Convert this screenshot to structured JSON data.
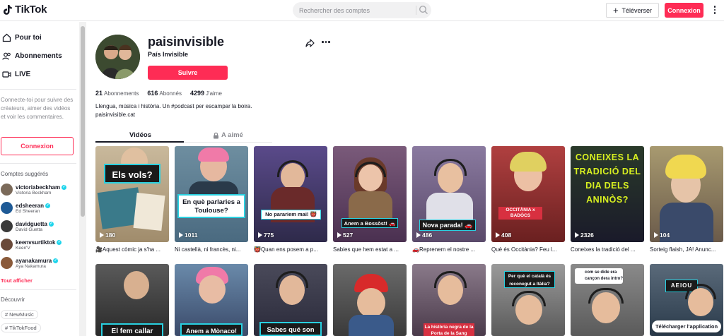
{
  "header": {
    "logo": "TikTok",
    "search_placeholder": "Rechercher des comptes",
    "upload_label": "Téléverser",
    "login_label": "Connexion"
  },
  "sidebar": {
    "nav": [
      {
        "label": "Pour toi",
        "icon": "home-icon"
      },
      {
        "label": "Abonnements",
        "icon": "people-icon"
      },
      {
        "label": "LIVE",
        "icon": "live-icon"
      }
    ],
    "login_prompt": "Connecte-toi pour suivre des créateurs, aimer des vidéos et voir les commentaires.",
    "login_label": "Connexion",
    "suggested_heading": "Comptes suggérés",
    "suggested": [
      {
        "username": "victoriabeckham",
        "name": "Victoria Beckham",
        "color": "#7b6a5a"
      },
      {
        "username": "edsheeran",
        "name": "Ed Sheeran",
        "color": "#1e5a96"
      },
      {
        "username": "davidguetta",
        "name": "David Guetta",
        "color": "#3a3a3a"
      },
      {
        "username": "keenvsurtiktok",
        "name": "Keen'V",
        "color": "#6a4a3a"
      },
      {
        "username": "ayanakamura",
        "name": "Aya Nakamura",
        "color": "#8a5a3a"
      }
    ],
    "see_all": "Tout afficher",
    "discover_heading": "Découvrir",
    "tags": [
      "NewMusic",
      "TikTokFood"
    ]
  },
  "profile": {
    "username": "paisinvisible",
    "display_name": "País Invisible",
    "follow_label": "Suivre",
    "following_count": "21",
    "following_label": "Abonnements",
    "followers_count": "616",
    "followers_label": "Abonnés",
    "likes_count": "4299",
    "likes_label": "J'aime",
    "bio_line1": "Llengua, música i història. Un #podcast per escampar la boira.",
    "bio_line2": "paisinvisible.cat"
  },
  "tabs": {
    "videos": "Vidéos",
    "liked": "A aimé"
  },
  "videos_row1": [
    {
      "views": "180",
      "desc": "🎥Aquest còmic ja s'ha ...",
      "caption": "Els vols?",
      "bg": "#b8a88e"
    },
    {
      "views": "1011",
      "desc": "Ni castellà, ni francès, ni...",
      "caption": "En què parlaries a Toulouse?",
      "bg": "#7a9aa8"
    },
    {
      "views": "775",
      "desc": "👹Quan ens posem a p...",
      "caption": "No parariem mai! 👹",
      "bg": "#5a4a7a"
    },
    {
      "views": "527",
      "desc": "Sabies que hem estat a ...",
      "caption": "Anem a Bossòst! 🚗",
      "bg": "#6a5070"
    },
    {
      "views": "486",
      "desc": "🚗Reprenem el nostre ...",
      "caption": "Nova parada! 🚗",
      "bg": "#7a6a8a"
    },
    {
      "views": "408",
      "desc": "Què és Occitània? Feu l...",
      "caption": "OCCITÀNIA x BADÒCS",
      "bg": "#8a5a5a"
    },
    {
      "views": "2326",
      "desc": "Coneixes la tradició del ...",
      "caption": "CONEIXES LA TRADICIÓ DEL DIA DELS ANINÒS?",
      "bg": "#2a2a3a"
    },
    {
      "views": "104",
      "desc": "Sorteig flaish, JA! Anunc...",
      "caption": "",
      "bg": "#9a8a6a"
    }
  ],
  "videos_row2": [
    {
      "caption": "El fem callar",
      "bg": "#4a4a4a"
    },
    {
      "caption": "Anem a Mònaco!",
      "bg": "#5a6a8a"
    },
    {
      "caption": "Sabes qué son",
      "bg": "#3a3a4a"
    },
    {
      "caption": "",
      "bg": "#6a6a6a"
    },
    {
      "caption": "La història negra de la Porta de la Sang",
      "bg": "#7a6a7a"
    },
    {
      "caption": "Per què el català és reconegut a Itàlia?",
      "bg": "#8a8a8a"
    },
    {
      "caption": "com se dide era cançon dera intro?",
      "bg": "#7a7a7a"
    },
    {
      "caption": "AEIOU",
      "bg": "#4a5a6a"
    }
  ],
  "download_label": "Télécharger l'application"
}
